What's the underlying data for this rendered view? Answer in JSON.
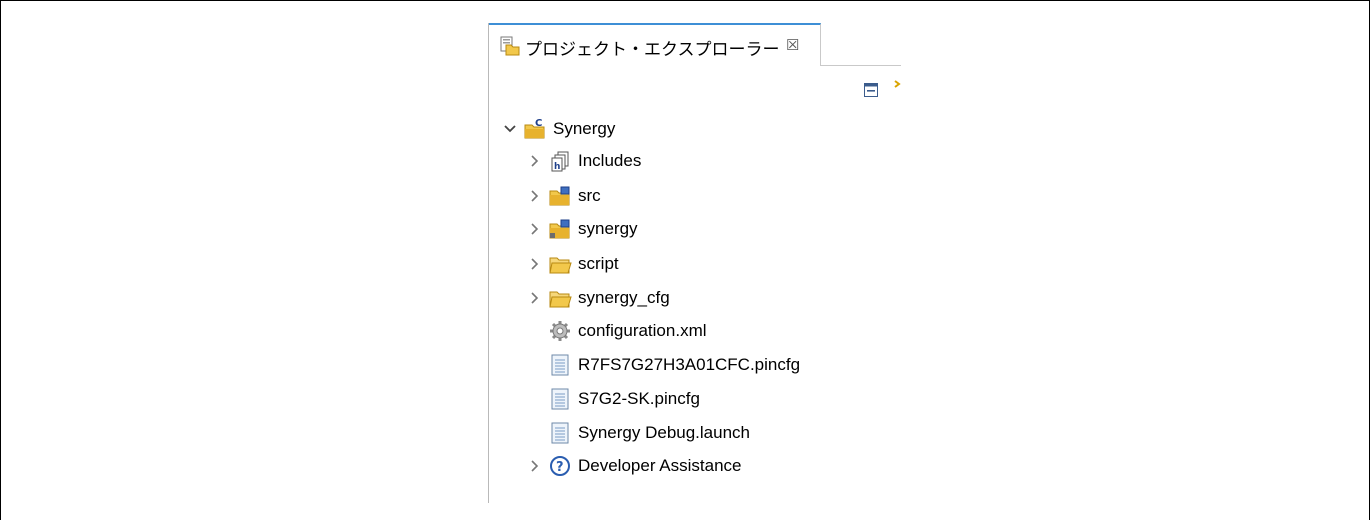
{
  "tab": {
    "title": "プロジェクト・エクスプローラー",
    "close_glyph": "☒"
  },
  "toolbar": {
    "collapse_icon": "collapse-all-icon"
  },
  "tree": {
    "root": {
      "label": "Synergy",
      "expanded": true,
      "icon": "c-project-icon"
    },
    "children": [
      {
        "label": "Includes",
        "icon": "includes-icon",
        "expandable": true
      },
      {
        "label": "src",
        "icon": "source-folder-icon",
        "expandable": true
      },
      {
        "label": "synergy",
        "icon": "source-folder-icon",
        "expandable": true
      },
      {
        "label": "script",
        "icon": "folder-icon",
        "expandable": true
      },
      {
        "label": "synergy_cfg",
        "icon": "folder-icon",
        "expandable": true
      },
      {
        "label": "configuration.xml",
        "icon": "gear-icon",
        "expandable": false
      },
      {
        "label": "R7FS7G27H3A01CFC.pincfg",
        "icon": "file-icon",
        "expandable": false
      },
      {
        "label": "S7G2-SK.pincfg",
        "icon": "file-icon",
        "expandable": false
      },
      {
        "label": "Synergy Debug.launch",
        "icon": "file-icon",
        "expandable": false
      },
      {
        "label": "Developer Assistance",
        "icon": "help-icon",
        "expandable": true
      }
    ]
  }
}
